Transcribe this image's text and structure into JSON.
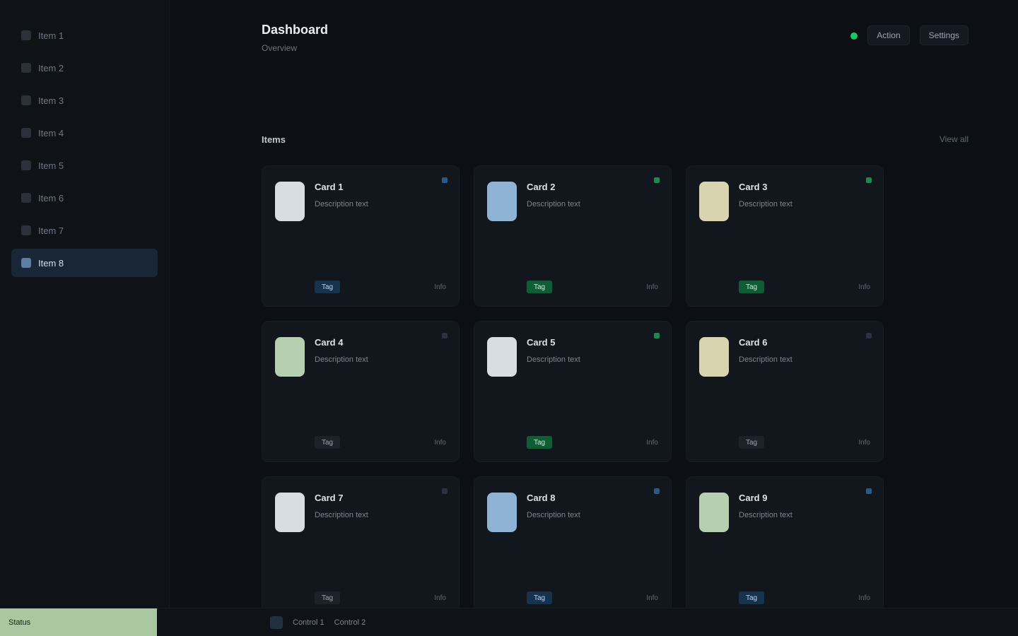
{
  "app": {
    "title": "Dashboard",
    "subtitle": "Overview"
  },
  "sidebar": {
    "items": [
      {
        "label": "Item 1"
      },
      {
        "label": "Item 2"
      },
      {
        "label": "Item 3"
      },
      {
        "label": "Item 4"
      },
      {
        "label": "Item 5"
      },
      {
        "label": "Item 6"
      },
      {
        "label": "Item 7"
      },
      {
        "label": "Item 8"
      }
    ]
  },
  "header": {
    "actions": [
      {
        "label": "Action"
      },
      {
        "label": "Settings"
      }
    ]
  },
  "section": {
    "title": "Items",
    "link": "View all"
  },
  "cards": [
    {
      "title": "Card 1",
      "desc": "Description text",
      "badge": "Tag",
      "meta": "Info",
      "badge_color": "#17324d"
    },
    {
      "title": "Card 2",
      "desc": "Description text",
      "badge": "Tag",
      "meta": "Info",
      "badge_color": "#0f5d35"
    },
    {
      "title": "Card 3",
      "desc": "Description text",
      "badge": "Tag",
      "meta": "Info",
      "badge_color": "#0f5d35"
    },
    {
      "title": "Card 4",
      "desc": "Description text",
      "badge": "Tag",
      "meta": "Info",
      "badge_color": "#1c2229"
    },
    {
      "title": "Card 5",
      "desc": "Description text",
      "badge": "Tag",
      "meta": "Info",
      "badge_color": "#0f5d35"
    },
    {
      "title": "Card 6",
      "desc": "Description text",
      "badge": "Tag",
      "meta": "Info",
      "badge_color": "#1c2229"
    },
    {
      "title": "Card 7",
      "desc": "Description text",
      "badge": "Tag",
      "meta": "Info",
      "badge_color": "#1c2229"
    },
    {
      "title": "Card 8",
      "desc": "Description text",
      "badge": "Tag",
      "meta": "Info",
      "badge_color": "#17324d"
    },
    {
      "title": "Card 9",
      "desc": "Description text",
      "badge": "Tag",
      "meta": "Info",
      "badge_color": "#17324d"
    }
  ],
  "bottombar": {
    "progress_label": "Status",
    "controls": [
      {
        "label": "Control 1"
      },
      {
        "label": "Control 2"
      }
    ]
  },
  "colors": {
    "accent_green": "#17c964",
    "accent_blue": "#5d7da3",
    "background": "#0c0f13"
  }
}
